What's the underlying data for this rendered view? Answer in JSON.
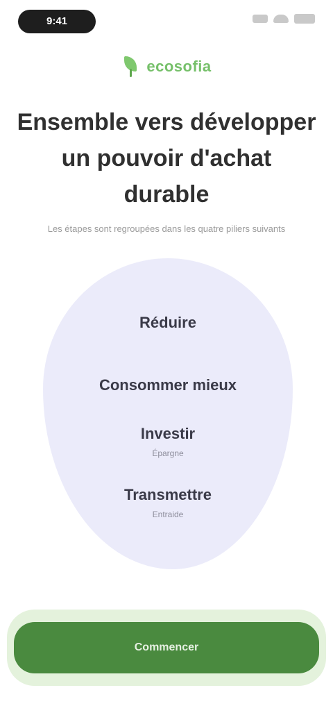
{
  "status_bar": {
    "time": "9:41"
  },
  "brand": {
    "name": "ecosofia",
    "icon": "leaf-icon",
    "color": "#76c06a"
  },
  "headline": "Ensemble vers développer un pouvoir d'achat durable",
  "subtitle": "Les étapes sont regroupées dans les quatre piliers suivants",
  "pillars": [
    {
      "title": "Réduire",
      "subtitle": ""
    },
    {
      "title": "Consommer mieux",
      "subtitle": ""
    },
    {
      "title": "Investir",
      "subtitle": "Épargne"
    },
    {
      "title": "Transmettre",
      "subtitle": "Entraide"
    }
  ],
  "cta": {
    "label": "Commencer",
    "color": "#4a8a3f"
  },
  "colors": {
    "blob": "#ebebfa",
    "text": "#303030"
  }
}
